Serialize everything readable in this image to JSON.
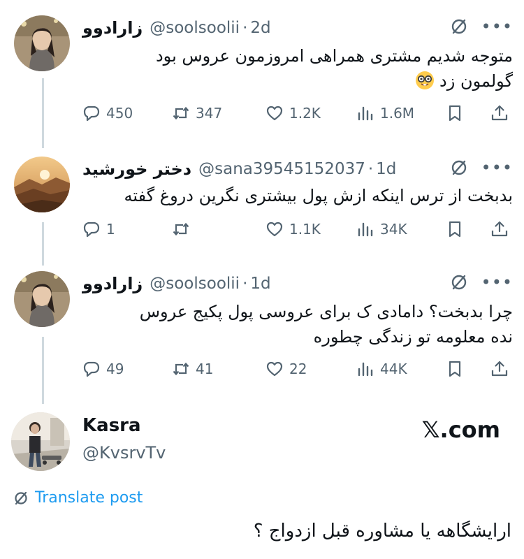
{
  "thread": [
    {
      "name": "زارادوو",
      "handle": "@soolsoolii",
      "separator": "·",
      "age": "2d",
      "text_lines": [
        "متوجه شدیم مشتری همراهی امروزمون عروس بود",
        "گولمون زد"
      ],
      "emoji": "nerd-face",
      "stats": {
        "replies": "450",
        "reposts": "347",
        "likes": "1.2K",
        "views": "1.6M"
      }
    },
    {
      "name": "دختر خورشید",
      "handle": "@sana39545152037",
      "separator": "·",
      "age": "1d",
      "text_lines": [
        "بدبخت از ترس اینکه ازش پول بیشتری نگرین دروغ گفته"
      ],
      "stats": {
        "replies": "1",
        "reposts": "",
        "likes": "1.1K",
        "views": "34K"
      }
    },
    {
      "name": "زارادوو",
      "handle": "@soolsoolii",
      "separator": "·",
      "age": "1d",
      "text_lines": [
        "چرا بدبخت؟ دامادی ک برای عروسی پول پکیج عروس",
        "نده معلومه تو زندگی چطوره"
      ],
      "stats": {
        "replies": "49",
        "reposts": "41",
        "likes": "22",
        "views": "44K"
      }
    }
  ],
  "author": {
    "name": "Kasra",
    "handle": "@KvsrvTv"
  },
  "site_label": "𝕏.com",
  "translate_label": "Translate post",
  "main_post_text": "ارایشگاهه یا مشاوره قبل ازدواج ؟",
  "icons": {
    "grok": "grok-icon",
    "more": "more-icon",
    "reply": "reply-icon",
    "repost": "repost-icon",
    "like": "heart-icon",
    "views": "views-icon",
    "bookmark": "bookmark-icon",
    "share": "share-icon",
    "translate": "translate-icon"
  },
  "colors": {
    "text": "#0f1419",
    "secondary": "#536471",
    "accent": "#1d9bf0",
    "thread_line": "#cfd9de"
  }
}
